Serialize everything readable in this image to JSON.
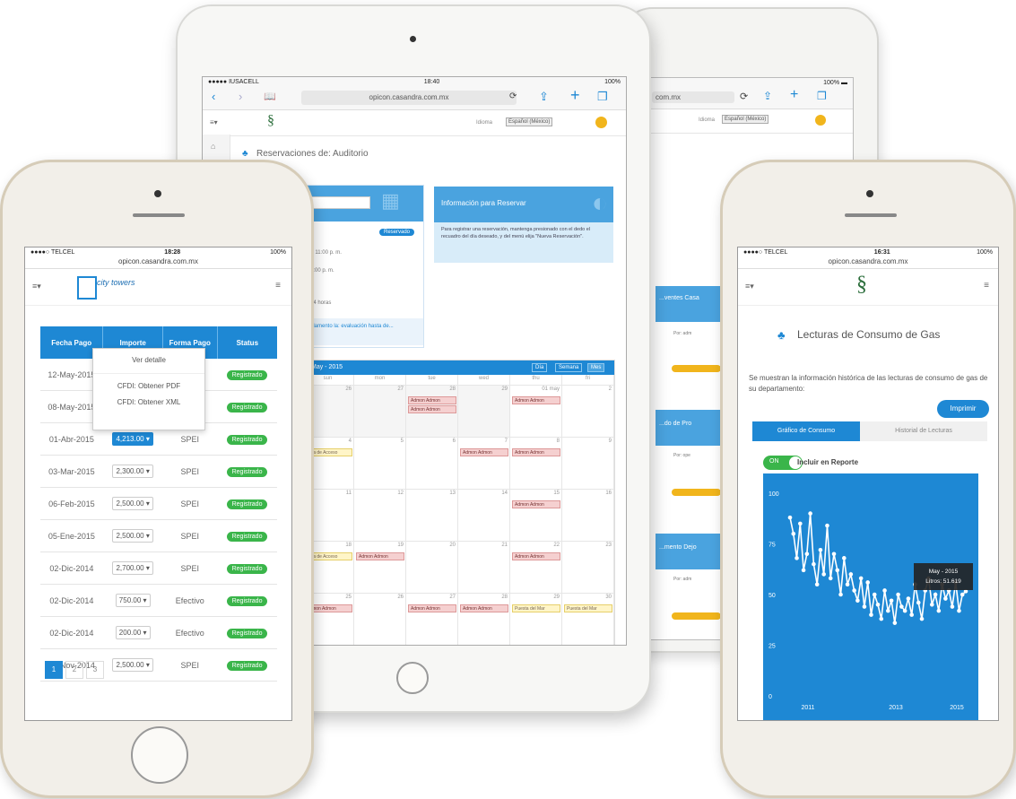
{
  "phone_left": {
    "status": {
      "carrier": "●●●●○ TELCEL",
      "time": "18:28",
      "battery": "100%"
    },
    "url": "opicon.casandra.com.mx",
    "logo_text": "city towers",
    "table": {
      "headers": [
        "Fecha Pago",
        "Importe",
        "Forma Pago",
        "Status"
      ],
      "rows": [
        {
          "fecha": "12-May-2015",
          "importe": "",
          "forma": "",
          "status": "Registrado"
        },
        {
          "fecha": "08-May-2015",
          "importe": "",
          "forma": "",
          "status": "Registrado"
        },
        {
          "fecha": "01-Abr-2015",
          "importe": "4,213.00 ▾",
          "forma": "SPEI",
          "status": "Registrado"
        },
        {
          "fecha": "03-Mar-2015",
          "importe": "2,300.00 ▾",
          "forma": "SPEI",
          "status": "Registrado"
        },
        {
          "fecha": "06-Feb-2015",
          "importe": "2,500.00 ▾",
          "forma": "SPEI",
          "status": "Registrado"
        },
        {
          "fecha": "05-Ene-2015",
          "importe": "2,500.00 ▾",
          "forma": "SPEI",
          "status": "Registrado"
        },
        {
          "fecha": "02-Dic-2014",
          "importe": "2,700.00 ▾",
          "forma": "SPEI",
          "status": "Registrado"
        },
        {
          "fecha": "02-Dic-2014",
          "importe": "750.00 ▾",
          "forma": "Efectivo",
          "status": "Registrado"
        },
        {
          "fecha": "02-Dic-2014",
          "importe": "200.00 ▾",
          "forma": "Efectivo",
          "status": "Registrado"
        },
        {
          "fecha": "25-Nov-2014",
          "importe": "2,500.00 ▾",
          "forma": "SPEI",
          "status": "Registrado"
        }
      ]
    },
    "dropdown": [
      "Ver detalle",
      "CFDI: Obtener PDF",
      "CFDI: Obtener XML"
    ],
    "pager": [
      "1",
      "2",
      "3"
    ]
  },
  "ipad": {
    "status": {
      "carrier": "●●●●● IUSACELL",
      "time": "18:40",
      "battery": "100%"
    },
    "url": "opicon.casandra.com.mx",
    "idioma_label": "Idioma",
    "idioma_value": "Español (México)",
    "page_title": "Reservaciones de: Auditorio",
    "badge": "Reservado",
    "hours": [
      "... - 11:00 p. m.",
      "...0:00 p. m.",
      "...: 4 horas"
    ],
    "reglamento": "...elamento la: evaluación hasta de...",
    "info_title": "Información para Reservar",
    "info_text": "Para registrar una reservación, mantenga presionado con el dedo el recuadro del día deseado, y del menú elija \"Nueva Reservación\".",
    "calendar": {
      "title": "May - 2015",
      "buttons": [
        "Día",
        "Semana",
        "Mes"
      ],
      "days": [
        "sun",
        "mon",
        "tue",
        "wed",
        "thu",
        "fri",
        "sat"
      ],
      "weeks": [
        [
          "",
          "26",
          "27",
          "28",
          "29",
          "01 may",
          "2"
        ],
        [
          "",
          "4",
          "5",
          "6",
          "7",
          "8",
          "9"
        ],
        [
          "",
          "11",
          "12",
          "13",
          "14",
          "15",
          "16"
        ],
        [
          "",
          "18",
          "19",
          "20",
          "21",
          "22",
          "23"
        ],
        [
          "",
          "25",
          "26",
          "27",
          "28",
          "29",
          "30"
        ]
      ],
      "events": {
        "admin": "Admon Admon",
        "admin2": "Admon Admon",
        "salon": "Sala de Acceso",
        "puesta": "Puesta del Mar"
      }
    }
  },
  "ipad_back": {
    "url": "com.mx",
    "idioma": "Idioma",
    "idioma_value": "Español (México)",
    "cards": [
      "...ventes Casa",
      "...do de Pro",
      "...mento Dejo"
    ],
    "por": [
      "Por: adm",
      "Por: ope",
      "Por: adm"
    ]
  },
  "phone_right": {
    "status": {
      "carrier": "●●●●○ TELCEL",
      "time": "16:31",
      "battery": "100%"
    },
    "url": "opicon.casandra.com.mx",
    "title": "Lecturas de Consumo de Gas",
    "description": "Se muestran la información histórica de las lecturas de consumo de gas de su departamento:",
    "print_button": "Imprimir",
    "tabs": [
      "Gráfico de Consumo",
      "Historial de Lecturas"
    ],
    "toggle_label": "ON",
    "include_label": "Incluir en Reporte",
    "tooltip": {
      "line1": "May - 2015",
      "line2": "Litros: 51.619"
    }
  },
  "chart_data": {
    "type": "line",
    "title": "",
    "xlabel": "",
    "ylabel": "",
    "x_ticks": [
      "2011",
      "2013",
      "2015"
    ],
    "y_ticks": [
      0,
      25,
      50,
      75,
      100
    ],
    "ylim": [
      0,
      100
    ],
    "x": [
      "2011-01",
      "2011-02",
      "2011-03",
      "2011-04",
      "2011-05",
      "2011-06",
      "2011-07",
      "2011-08",
      "2011-09",
      "2011-10",
      "2011-11",
      "2011-12",
      "2012-01",
      "2012-02",
      "2012-03",
      "2012-04",
      "2012-05",
      "2012-06",
      "2012-07",
      "2012-08",
      "2012-09",
      "2012-10",
      "2012-11",
      "2012-12",
      "2013-01",
      "2013-02",
      "2013-03",
      "2013-04",
      "2013-05",
      "2013-06",
      "2013-07",
      "2013-08",
      "2013-09",
      "2013-10",
      "2013-11",
      "2013-12",
      "2014-01",
      "2014-02",
      "2014-03",
      "2014-04",
      "2014-05",
      "2014-06",
      "2014-07",
      "2014-08",
      "2014-09",
      "2014-10",
      "2014-11",
      "2014-12",
      "2015-01",
      "2015-02",
      "2015-03",
      "2015-04",
      "2015-05"
    ],
    "values": [
      88,
      80,
      68,
      85,
      62,
      70,
      90,
      65,
      55,
      72,
      60,
      84,
      58,
      70,
      62,
      50,
      68,
      55,
      60,
      52,
      47,
      58,
      44,
      56,
      40,
      50,
      45,
      38,
      52,
      42,
      47,
      36,
      50,
      44,
      42,
      48,
      40,
      55,
      46,
      38,
      52,
      58,
      45,
      50,
      42,
      55,
      48,
      52,
      44,
      56,
      42,
      50,
      51.6
    ],
    "grid": false
  },
  "colors": {
    "accent": "#1e88d4",
    "success": "#3ab54a",
    "event": "#f5d0d0"
  }
}
